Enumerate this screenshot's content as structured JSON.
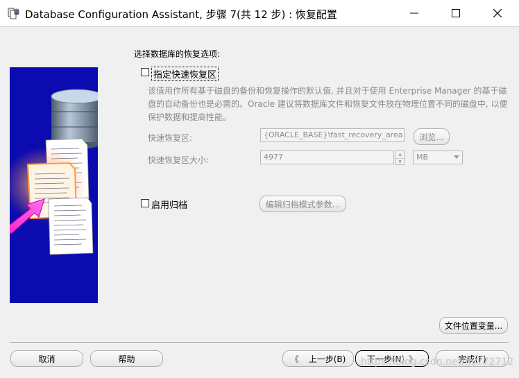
{
  "window": {
    "title": "Database Configuration Assistant, 步骤 7(共 12 步) : 恢复配置"
  },
  "recovery": {
    "heading": "选择数据库的恢复选项:",
    "fast_recovery": {
      "checkbox_label": "指定快速恢复区",
      "checked": false,
      "description": "该值用作所有基于磁盘的备份和恢复操作的默认值, 并且对于使用 Enterprise Manager 的基于磁盘的自动备份也是必需的。Oracle 建议将数据库文件和恢复文件放在物理位置不同的磁盘中, 以便保护数据和提高性能。",
      "area_label": "快速恢复区:",
      "area_value": "{ORACLE_BASE}\\fast_recovery_area",
      "browse_label": "浏览...",
      "size_label": "快速恢复区大小:",
      "size_value": "4977",
      "unit_value": "MB"
    },
    "archive": {
      "checkbox_label": "启用归档",
      "checked": false,
      "edit_params_label": "编辑归档模式参数..."
    }
  },
  "buttons": {
    "file_locations": "文件位置变量...",
    "cancel": "取消",
    "help": "帮助",
    "back": "上一步(B)",
    "next": "下一步(N)",
    "finish": "完成(F)"
  },
  "watermark": "https://blog.csdn.net/fly772712",
  "icons": {
    "app": "database-installer-icon",
    "minimize": "minimize-icon",
    "maximize": "maximize-icon",
    "close": "close-icon",
    "back": "chevron-left-double-icon",
    "next": "chevron-right-double-icon"
  },
  "colors": {
    "side_panel_bg": "#0b0bb0",
    "arrow": "#ff29d4",
    "disabled_text": "#8a8a8a"
  }
}
